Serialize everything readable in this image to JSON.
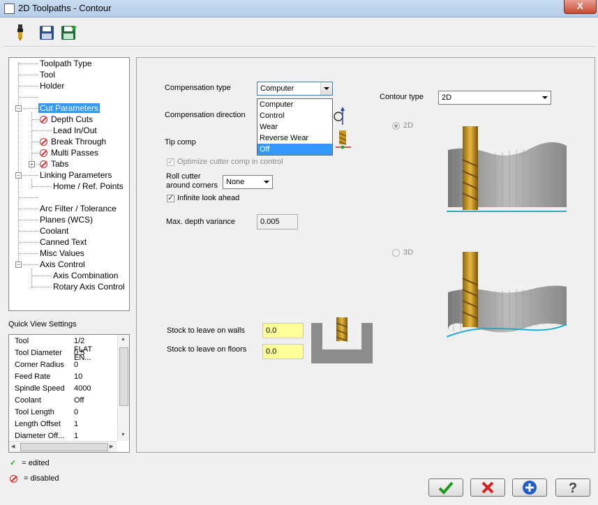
{
  "window": {
    "title": "2D Toolpaths - Contour",
    "close_label": "X"
  },
  "toolbar": {
    "icons": [
      "tool-icon",
      "save-icon",
      "save-to-library-icon"
    ]
  },
  "tree": {
    "items": [
      {
        "label": "Toolpath Type"
      },
      {
        "label": "Tool"
      },
      {
        "label": "Holder"
      },
      {
        "label": ""
      },
      {
        "label": "Cut Parameters",
        "selected": true
      },
      {
        "label": "Depth Cuts",
        "disabled": true
      },
      {
        "label": "Lead In/Out"
      },
      {
        "label": "Break Through",
        "disabled": true
      },
      {
        "label": "Multi Passes",
        "disabled": true
      },
      {
        "label": "Tabs",
        "disabled": true
      },
      {
        "label": "Linking Parameters"
      },
      {
        "label": "Home / Ref. Points"
      },
      {
        "label": ""
      },
      {
        "label": "Arc Filter / Tolerance"
      },
      {
        "label": "Planes (WCS)"
      },
      {
        "label": "Coolant"
      },
      {
        "label": "Canned Text"
      },
      {
        "label": "Misc Values"
      },
      {
        "label": "Axis Control"
      },
      {
        "label": "Axis Combination"
      },
      {
        "label": "Rotary Axis Control"
      }
    ]
  },
  "quick_view": {
    "title": "Quick View Settings",
    "rows": [
      {
        "key": "Tool",
        "value": "1/2 FLAT EN..."
      },
      {
        "key": "Tool Diameter",
        "value": "0.5"
      },
      {
        "key": "Corner Radius",
        "value": "0"
      },
      {
        "key": "Feed Rate",
        "value": "10"
      },
      {
        "key": "Spindle Speed",
        "value": "4000"
      },
      {
        "key": "Coolant",
        "value": "Off"
      },
      {
        "key": "Tool Length",
        "value": "0"
      },
      {
        "key": "Length Offset",
        "value": "1"
      },
      {
        "key": "Diameter Off...",
        "value": "1"
      }
    ]
  },
  "legend": {
    "edited": "= edited",
    "disabled": "= disabled"
  },
  "params": {
    "comp_type_label": "Compensation type",
    "comp_type_value": "Computer",
    "comp_type_options": [
      "Computer",
      "Control",
      "Wear",
      "Reverse Wear",
      "Off"
    ],
    "comp_type_highlighted": "Off",
    "comp_direction_label": "Compensation direction",
    "tip_comp_label": "Tip comp",
    "optimize_label": "Optimize cutter comp in control",
    "roll_cutter_label_1": "Roll cutter",
    "roll_cutter_label_2": "around corners",
    "roll_cutter_value": "None",
    "infinite_lookahead_label": "Infinite look ahead",
    "max_depth_label": "Max. depth variance",
    "max_depth_value": "0.005",
    "contour_type_label": "Contour type",
    "contour_type_value": "2D",
    "radio_2d_label": "2D",
    "radio_3d_label": "3D",
    "stock_walls_label": "Stock to leave on walls",
    "stock_walls_value": "0.0",
    "stock_floors_label": "Stock to leave on floors",
    "stock_floors_value": "0.0"
  },
  "buttons": [
    "ok-icon",
    "cancel-icon",
    "add-icon",
    "help-icon"
  ],
  "colors": {
    "selection": "#3399ff",
    "input_yellow": "#ffff99",
    "disabled_red": "#dd2222",
    "edited_green": "#22aa22"
  }
}
